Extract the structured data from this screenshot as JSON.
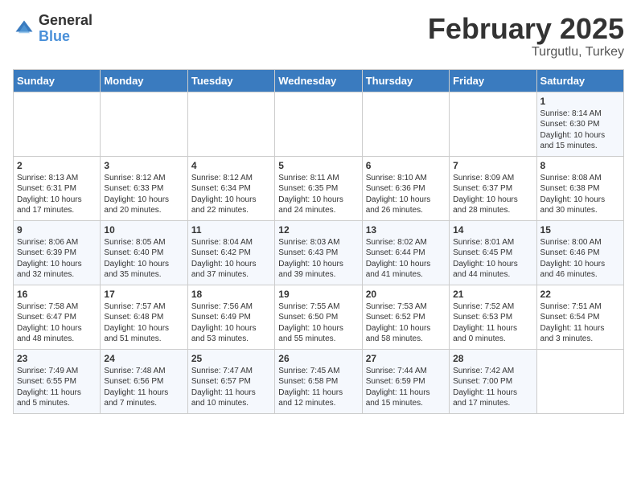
{
  "header": {
    "logo_general": "General",
    "logo_blue": "Blue",
    "month_title": "February 2025",
    "location": "Turgutlu, Turkey"
  },
  "days_of_week": [
    "Sunday",
    "Monday",
    "Tuesday",
    "Wednesday",
    "Thursday",
    "Friday",
    "Saturday"
  ],
  "weeks": [
    [
      {
        "day": "",
        "info": ""
      },
      {
        "day": "",
        "info": ""
      },
      {
        "day": "",
        "info": ""
      },
      {
        "day": "",
        "info": ""
      },
      {
        "day": "",
        "info": ""
      },
      {
        "day": "",
        "info": ""
      },
      {
        "day": "1",
        "info": "Sunrise: 8:14 AM\nSunset: 6:30 PM\nDaylight: 10 hours\nand 15 minutes."
      }
    ],
    [
      {
        "day": "2",
        "info": "Sunrise: 8:13 AM\nSunset: 6:31 PM\nDaylight: 10 hours\nand 17 minutes."
      },
      {
        "day": "3",
        "info": "Sunrise: 8:12 AM\nSunset: 6:33 PM\nDaylight: 10 hours\nand 20 minutes."
      },
      {
        "day": "4",
        "info": "Sunrise: 8:12 AM\nSunset: 6:34 PM\nDaylight: 10 hours\nand 22 minutes."
      },
      {
        "day": "5",
        "info": "Sunrise: 8:11 AM\nSunset: 6:35 PM\nDaylight: 10 hours\nand 24 minutes."
      },
      {
        "day": "6",
        "info": "Sunrise: 8:10 AM\nSunset: 6:36 PM\nDaylight: 10 hours\nand 26 minutes."
      },
      {
        "day": "7",
        "info": "Sunrise: 8:09 AM\nSunset: 6:37 PM\nDaylight: 10 hours\nand 28 minutes."
      },
      {
        "day": "8",
        "info": "Sunrise: 8:08 AM\nSunset: 6:38 PM\nDaylight: 10 hours\nand 30 minutes."
      }
    ],
    [
      {
        "day": "9",
        "info": "Sunrise: 8:06 AM\nSunset: 6:39 PM\nDaylight: 10 hours\nand 32 minutes."
      },
      {
        "day": "10",
        "info": "Sunrise: 8:05 AM\nSunset: 6:40 PM\nDaylight: 10 hours\nand 35 minutes."
      },
      {
        "day": "11",
        "info": "Sunrise: 8:04 AM\nSunset: 6:42 PM\nDaylight: 10 hours\nand 37 minutes."
      },
      {
        "day": "12",
        "info": "Sunrise: 8:03 AM\nSunset: 6:43 PM\nDaylight: 10 hours\nand 39 minutes."
      },
      {
        "day": "13",
        "info": "Sunrise: 8:02 AM\nSunset: 6:44 PM\nDaylight: 10 hours\nand 41 minutes."
      },
      {
        "day": "14",
        "info": "Sunrise: 8:01 AM\nSunset: 6:45 PM\nDaylight: 10 hours\nand 44 minutes."
      },
      {
        "day": "15",
        "info": "Sunrise: 8:00 AM\nSunset: 6:46 PM\nDaylight: 10 hours\nand 46 minutes."
      }
    ],
    [
      {
        "day": "16",
        "info": "Sunrise: 7:58 AM\nSunset: 6:47 PM\nDaylight: 10 hours\nand 48 minutes."
      },
      {
        "day": "17",
        "info": "Sunrise: 7:57 AM\nSunset: 6:48 PM\nDaylight: 10 hours\nand 51 minutes."
      },
      {
        "day": "18",
        "info": "Sunrise: 7:56 AM\nSunset: 6:49 PM\nDaylight: 10 hours\nand 53 minutes."
      },
      {
        "day": "19",
        "info": "Sunrise: 7:55 AM\nSunset: 6:50 PM\nDaylight: 10 hours\nand 55 minutes."
      },
      {
        "day": "20",
        "info": "Sunrise: 7:53 AM\nSunset: 6:52 PM\nDaylight: 10 hours\nand 58 minutes."
      },
      {
        "day": "21",
        "info": "Sunrise: 7:52 AM\nSunset: 6:53 PM\nDaylight: 11 hours\nand 0 minutes."
      },
      {
        "day": "22",
        "info": "Sunrise: 7:51 AM\nSunset: 6:54 PM\nDaylight: 11 hours\nand 3 minutes."
      }
    ],
    [
      {
        "day": "23",
        "info": "Sunrise: 7:49 AM\nSunset: 6:55 PM\nDaylight: 11 hours\nand 5 minutes."
      },
      {
        "day": "24",
        "info": "Sunrise: 7:48 AM\nSunset: 6:56 PM\nDaylight: 11 hours\nand 7 minutes."
      },
      {
        "day": "25",
        "info": "Sunrise: 7:47 AM\nSunset: 6:57 PM\nDaylight: 11 hours\nand 10 minutes."
      },
      {
        "day": "26",
        "info": "Sunrise: 7:45 AM\nSunset: 6:58 PM\nDaylight: 11 hours\nand 12 minutes."
      },
      {
        "day": "27",
        "info": "Sunrise: 7:44 AM\nSunset: 6:59 PM\nDaylight: 11 hours\nand 15 minutes."
      },
      {
        "day": "28",
        "info": "Sunrise: 7:42 AM\nSunset: 7:00 PM\nDaylight: 11 hours\nand 17 minutes."
      },
      {
        "day": "",
        "info": ""
      }
    ]
  ]
}
